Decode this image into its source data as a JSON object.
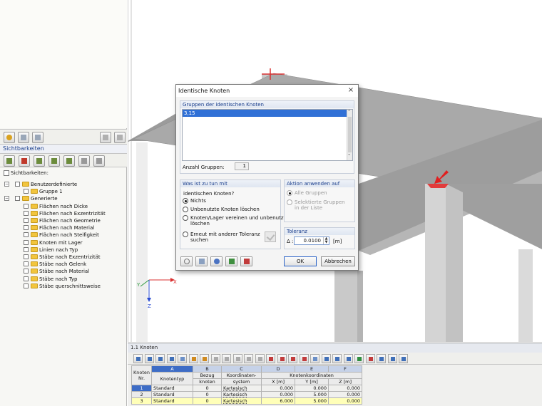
{
  "left_panel": {
    "section_header": "Sichtbarkeiten",
    "checkbox_label": "Sichtbarkeiten:",
    "tree": [
      {
        "label": "Benutzerdefinierte",
        "level": 0
      },
      {
        "label": "Gruppe 1",
        "level": 1
      },
      {
        "label": "Generierte",
        "level": 0
      },
      {
        "label": "Flächen nach Dicke",
        "level": 1
      },
      {
        "label": "Flächen nach Exzentrizität",
        "level": 1
      },
      {
        "label": "Flächen nach Geometrie",
        "level": 1
      },
      {
        "label": "Flächen nach Material",
        "level": 1
      },
      {
        "label": "Flächen nach Steifigkeit",
        "level": 1
      },
      {
        "label": "Knoten mit Lager",
        "level": 1
      },
      {
        "label": "Linien nach Typ",
        "level": 1
      },
      {
        "label": "Stäbe nach Exzentrizität",
        "level": 1
      },
      {
        "label": "Stäbe nach Gelenk",
        "level": 1
      },
      {
        "label": "Stäbe nach Material",
        "level": 1
      },
      {
        "label": "Stäbe nach Typ",
        "level": 1
      },
      {
        "label": "Stäbe querschnittsweise",
        "level": 1
      }
    ]
  },
  "axes": {
    "x": "X",
    "y": "Y",
    "z": "Z"
  },
  "dialog": {
    "title": "Identische Knoten",
    "close_glyph": "×",
    "groups_header": "Gruppen der identischen Knoten",
    "groups_list": [
      "3,15"
    ],
    "group_count_label": "Anzahl Gruppen:",
    "group_count_value": "1",
    "what_header": "Was ist zu tun mit",
    "what_sub": "identischen Knoten?",
    "options": {
      "nothing": "Nichts",
      "delete_unused": "Unbenutzte Knoten löschen",
      "merge_line1": "Knoten/Lager vereinen und unbenutzte",
      "merge_line2": "löschen",
      "research_line1": "Erneut mit anderer Toleranz",
      "research_line2": "suchen"
    },
    "apply_header": "Aktion anwenden auf",
    "apply": {
      "all": "Alle Gruppen",
      "selected_line1": "Selektierte Gruppen",
      "selected_line2": "in der Liste"
    },
    "tolerance_header": "Toleranz",
    "tolerance_prefix": "Δ :",
    "tolerance_value": "0.0100",
    "tolerance_unit": "[m]",
    "ok_label": "OK",
    "cancel_label": "Abbrechen"
  },
  "table_panel": {
    "title": "1.1 Knoten",
    "col_letters": [
      "A",
      "B",
      "C",
      "D",
      "E",
      "F"
    ],
    "header": {
      "row_no_1": "Knoten",
      "row_no_2": "Nr.",
      "a": "Knotentyp",
      "b1": "Bezug",
      "b2": "knoten",
      "c1": "Koordinaten-",
      "c2": "system",
      "coords": "Knotenkoordinaten",
      "x": "X [m]",
      "y": "Y [m]",
      "z": "Z [m]"
    },
    "rows": [
      {
        "no": "1",
        "type": "Standard",
        "ref": "0",
        "sys": "Kartesisch",
        "x": "0.000",
        "y": "0.000",
        "z": "0.000"
      },
      {
        "no": "2",
        "type": "Standard",
        "ref": "0",
        "sys": "Kartesisch",
        "x": "0.000",
        "y": "5.000",
        "z": "0.000"
      },
      {
        "no": "3",
        "type": "Standard",
        "ref": "0",
        "sys": "Kartesisch",
        "x": "6.000",
        "y": "5.000",
        "z": "0.000"
      }
    ]
  }
}
